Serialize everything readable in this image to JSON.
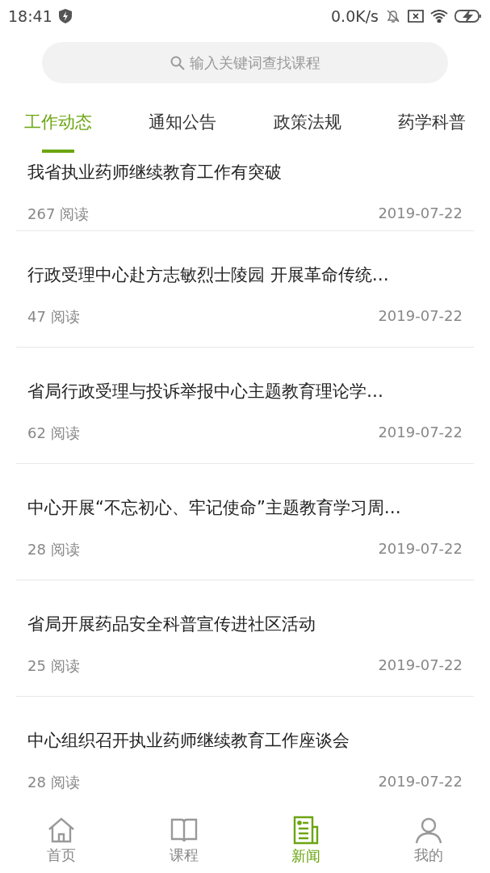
{
  "status_bar": {
    "time": "18:41",
    "speed": "0.0K/s"
  },
  "search": {
    "placeholder": "输入关键词查找课程"
  },
  "tabs": [
    {
      "label": "工作动态",
      "selected": true
    },
    {
      "label": "通知公告",
      "selected": false
    },
    {
      "label": "政策法规",
      "selected": false
    },
    {
      "label": "药学科普",
      "selected": false
    }
  ],
  "news": [
    {
      "title": "我省执业药师继续教育工作有突破",
      "reads": "267 阅读",
      "date": "2019-07-22"
    },
    {
      "title": "行政受理中心赴方志敏烈士陵园 开展革命传统…",
      "reads": "47 阅读",
      "date": "2019-07-22"
    },
    {
      "title": "省局行政受理与投诉举报中心主题教育理论学…",
      "reads": "62 阅读",
      "date": "2019-07-22"
    },
    {
      "title": "中心开展“不忘初心、牢记使命”主题教育学习周…",
      "reads": "28 阅读",
      "date": "2019-07-22"
    },
    {
      "title": "省局开展药品安全科普宣传进社区活动",
      "reads": "25 阅读",
      "date": "2019-07-22"
    },
    {
      "title": "中心组织召开执业药师继续教育工作座谈会",
      "reads": "28 阅读",
      "date": "2019-07-22"
    }
  ],
  "bottom_nav": [
    {
      "kind": "home",
      "label": "首页",
      "selected": false
    },
    {
      "kind": "course",
      "label": "课程",
      "selected": false
    },
    {
      "kind": "news",
      "label": "新闻",
      "selected": true
    },
    {
      "kind": "profile",
      "label": "我的",
      "selected": false
    }
  ]
}
